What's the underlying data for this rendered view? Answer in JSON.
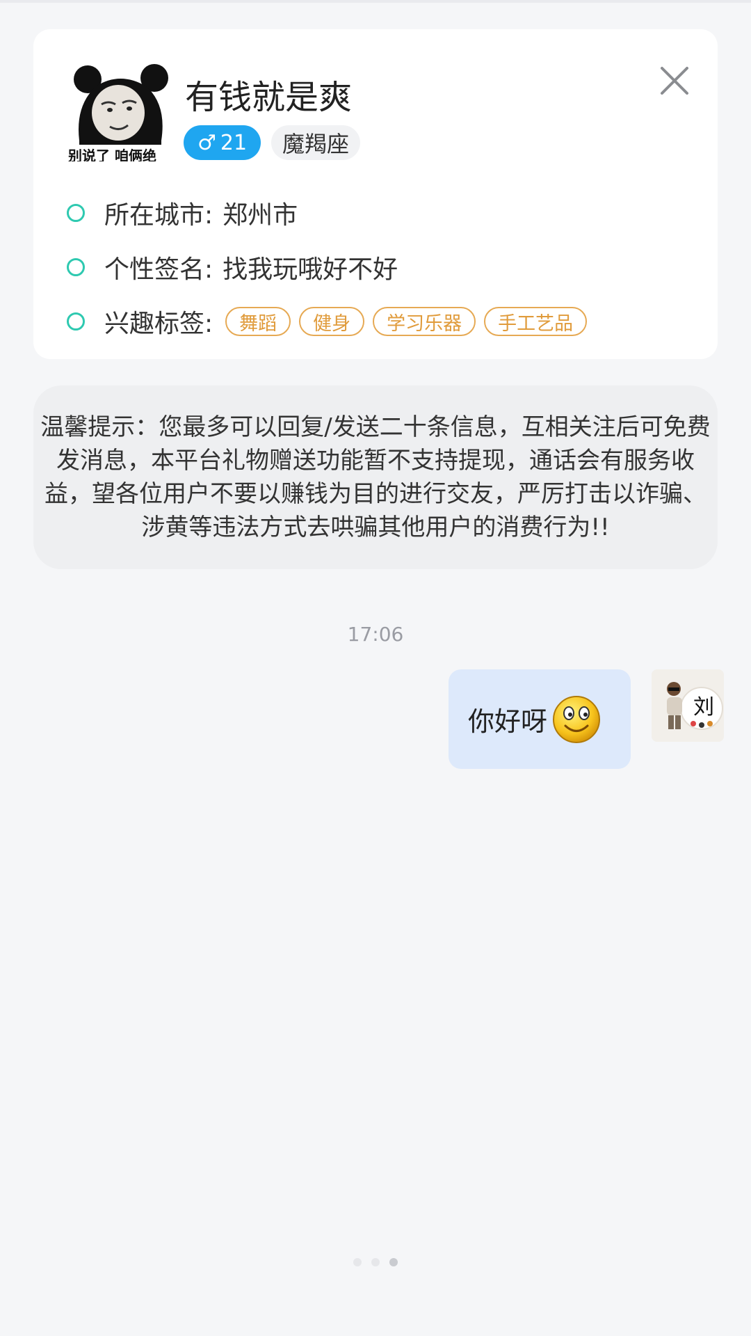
{
  "profile": {
    "username": "有钱就是爽",
    "gender_symbol": "♂",
    "age": "21",
    "zodiac": "魔羯座",
    "avatar_caption": "别说了 咱俩绝"
  },
  "info": {
    "city_label": "所在城市:",
    "city_value": "郑州市",
    "signature_label": "个性签名:",
    "signature_value": "找我玩哦好不好",
    "interests_label": "兴趣标签:",
    "interest_tags": [
      "舞蹈",
      "健身",
      "学习乐器",
      "手工艺品"
    ]
  },
  "notice": {
    "text": "温馨提示：您最多可以回复/发送二十条信息，互相关注后可免费发消息，本平台礼物赠送功能暂不支持提现，通话会有服务收益，望各位用户不要以赚钱为目的进行交友，严厉打击以诈骗、涉黄等违法方式去哄骗其他用户的消费行为!!"
  },
  "chat": {
    "timestamp": "17:06",
    "messages": [
      {
        "text": "你好呀",
        "emoji": "smile-emoji"
      }
    ],
    "my_avatar_text": "刘"
  },
  "pager": {
    "pages": 3,
    "active_index": 2
  },
  "colors": {
    "accent_teal": "#2ec9b0",
    "gender_blue": "#1fa6f0",
    "tag_orange": "#e09b3b",
    "bubble_blue": "#dde9fb"
  },
  "icons": [
    "close-icon",
    "male-icon",
    "smile-emoji"
  ]
}
